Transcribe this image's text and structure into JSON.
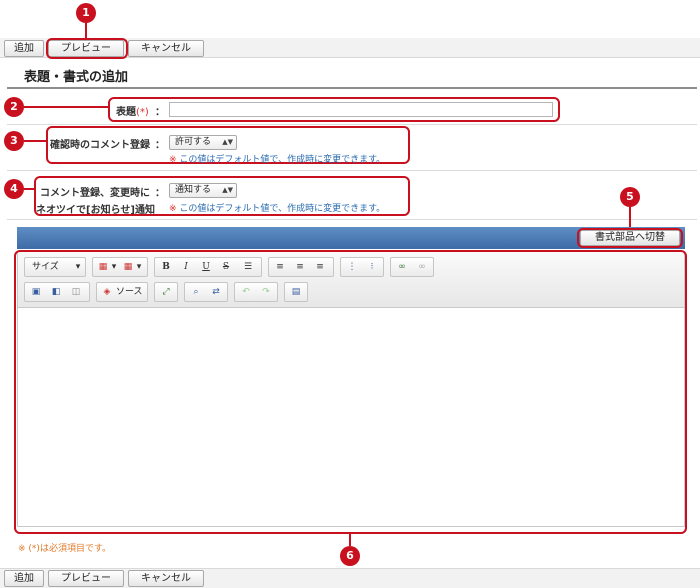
{
  "actions": {
    "add_label": "追加",
    "preview_label": "プレビュー",
    "cancel_label": "キャンセル"
  },
  "page": {
    "title": "表題・書式の追加"
  },
  "form": {
    "subject": {
      "label": "表題",
      "required_mark": "(*)",
      "colon": "：",
      "value": ""
    },
    "comment_confirm": {
      "label": "確認時のコメント登録",
      "colon": "：",
      "selected": "許可する",
      "note_mark": "※",
      "note": "この値はデフォルト値で、作成時に変更できます。"
    },
    "comment_notify": {
      "label_line1": "コメント登録、変更時に",
      "label_line2": "ネオツイで[お知らせ]通知",
      "colon": "：",
      "selected": "通知する",
      "note_mark": "※",
      "note": "この値はデフォルト値で、作成時に変更できます。"
    }
  },
  "editor": {
    "switch_label": "書式部品へ切替",
    "size_combo": "サイズ",
    "source_label": "ソース",
    "icons": [
      "text-color-icon",
      "table-icon",
      "bold-icon",
      "italic-icon",
      "underline-icon",
      "strikethrough-icon",
      "horizontal-rule-icon",
      "align-left-icon",
      "align-center-icon",
      "align-right-icon",
      "ordered-list-icon",
      "unordered-list-icon",
      "link-icon",
      "unlink-icon",
      "image-icon",
      "flash-icon",
      "page-break-icon",
      "source-icon",
      "maximize-icon",
      "find-icon",
      "replace-icon",
      "undo-icon",
      "redo-icon",
      "show-blocks-icon"
    ],
    "glyphs": {
      "bold": "B",
      "italic": "I",
      "underline": "U",
      "strike": "S"
    }
  },
  "footer": {
    "required_note_mark": "※",
    "required_note": "(*)は必須項目です。"
  },
  "callouts": [
    "1",
    "2",
    "3",
    "4",
    "5",
    "6"
  ],
  "colors": {
    "callout_red": "#c9101e",
    "header_blue": "#3d6ba6",
    "note_blue": "#2b6cb0",
    "required_orange": "#e07a2b"
  }
}
